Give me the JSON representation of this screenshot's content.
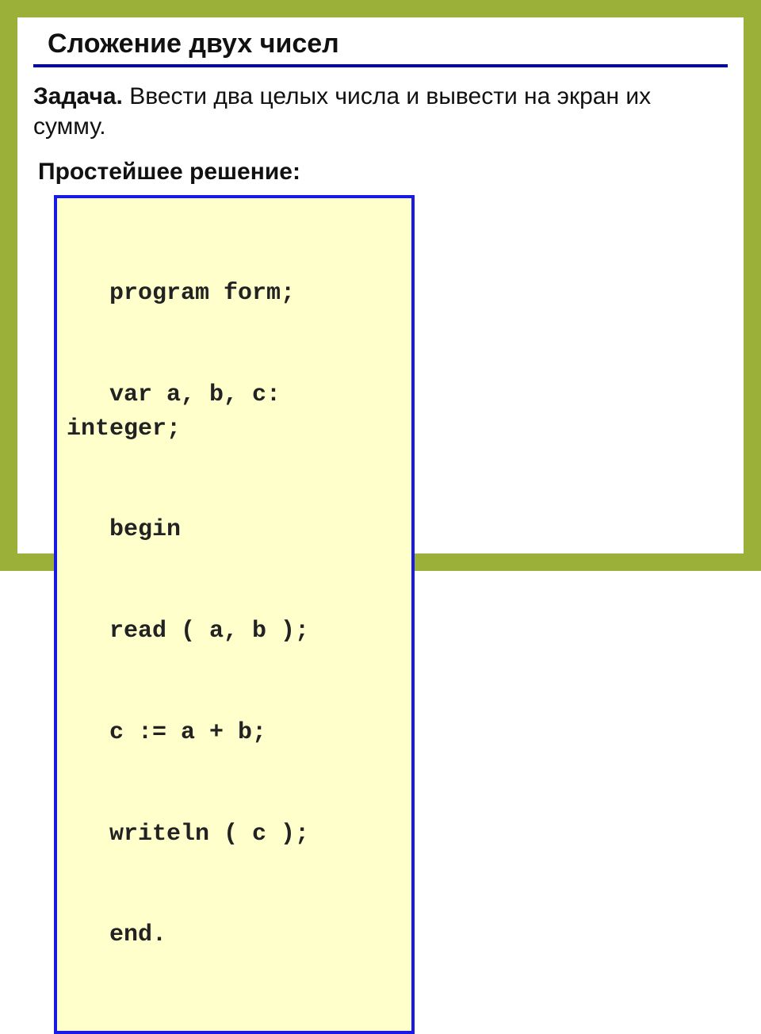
{
  "title": "Сложение двух чисел",
  "task": {
    "label": "Задача.",
    "text": " Ввести два целых числа и вывести на экран их сумму."
  },
  "subhead": "Простейшее решение:",
  "code_lines": [
    "   program form;",
    "   var a, b, c: integer;",
    "   begin",
    "   read ( a, b );",
    "   c := a + b;",
    "   writeln ( c );",
    "   end."
  ]
}
